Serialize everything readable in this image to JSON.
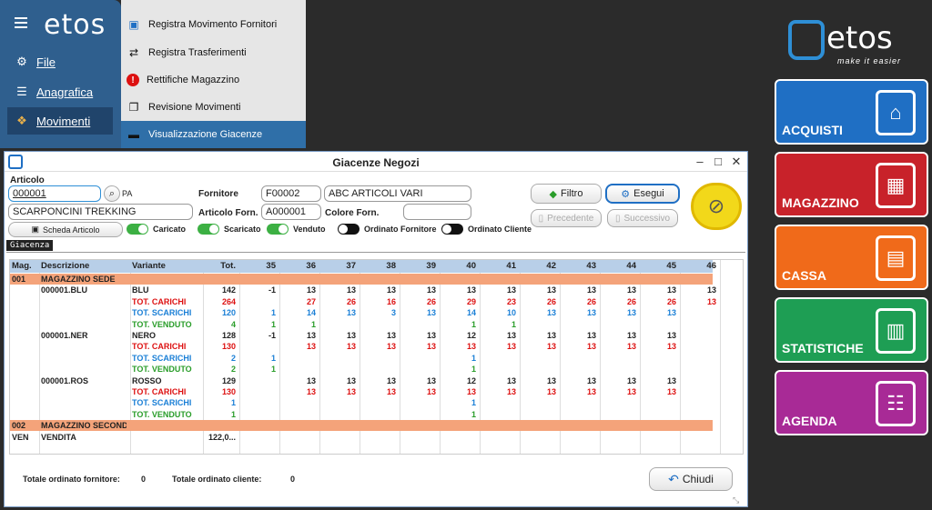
{
  "sidebar": {
    "logo": "etos",
    "items": [
      {
        "label": "File",
        "icon": "gear-icon"
      },
      {
        "label": "Anagrafica",
        "icon": "database-icon"
      },
      {
        "label": "Movimenti",
        "icon": "boxes-icon"
      }
    ]
  },
  "submenu": [
    {
      "label": "Registra Movimento Fornitori",
      "icon": "bag-icon"
    },
    {
      "label": "Registra Trasferimenti",
      "icon": "transfer-icon"
    },
    {
      "label": "Rettifiche Magazzino",
      "icon": "alert-icon"
    },
    {
      "label": "Revisione Movimenti",
      "icon": "documents-icon"
    },
    {
      "label": "Visualizzazione Giacenze",
      "icon": "archive-icon"
    }
  ],
  "brand": {
    "name": "etos",
    "tagline": "make it easier",
    "accent": "#2e8fd6"
  },
  "tiles": [
    {
      "label": "ACQUISTI",
      "color": "#1f6fc4",
      "icon": "shopping-bag-icon"
    },
    {
      "label": "MAGAZZINO",
      "color": "#c8222a",
      "icon": "hand-truck-icon"
    },
    {
      "label": "CASSA",
      "color": "#f06a1a",
      "icon": "cash-register-icon"
    },
    {
      "label": "STATISTICHE",
      "color": "#1e9e54",
      "icon": "chart-icon"
    },
    {
      "label": "AGENDA",
      "color": "#a82a96",
      "icon": "notebook-icon"
    }
  ],
  "window": {
    "title": "Giacenze Negozi",
    "articolo_label": "Articolo",
    "articolo_code": "000001",
    "pa": "PA",
    "articolo_desc": "SCARPONCINI TREKKING",
    "scheda_button": "Scheda Articolo",
    "fornitore_label": "Fornitore",
    "fornitore_code": "F00002",
    "fornitore_name": "ABC ARTICOLI VARI",
    "articolo_forn_label": "Articolo Forn.",
    "articolo_forn_value": "A000001",
    "colore_forn_label": "Colore Forn.",
    "colore_forn_value": "",
    "filtro_button": "Filtro",
    "esegui_button": "Esegui",
    "precedente_button": "Precedente",
    "successivo_button": "Successivo",
    "toggles": [
      {
        "label": "Caricato",
        "on": true
      },
      {
        "label": "Scaricato",
        "on": true
      },
      {
        "label": "Venduto",
        "on": true
      },
      {
        "label": "Ordinato Fornitore",
        "on": false
      },
      {
        "label": "Ordinato Cliente",
        "on": false
      }
    ],
    "tab_label": "Giacenza",
    "totale_fornitore_label": "Totale ordinato fornitore:",
    "totale_fornitore_value": "0",
    "totale_cliente_label": "Totale ordinato cliente:",
    "totale_cliente_value": "0",
    "chiudi_button": "Chiudi"
  },
  "grid": {
    "headers": [
      "Mag.",
      "Descrizione",
      "Variante",
      "Tot.",
      "35",
      "36",
      "37",
      "38",
      "39",
      "40",
      "41",
      "42",
      "43",
      "44",
      "45",
      "46"
    ],
    "rows": [
      {
        "kind": "group",
        "cells": [
          "001",
          "MAGAZZINO SEDE",
          "",
          "",
          "",
          "",
          "",
          "",
          "",
          "",
          "",
          "",
          "",
          "",
          "",
          ""
        ]
      },
      {
        "kind": "main",
        "cells": [
          "",
          "000001.BLU",
          "BLU",
          "142",
          "-1",
          "13",
          "13",
          "13",
          "13",
          "13",
          "13",
          "13",
          "13",
          "13",
          "13",
          "13"
        ]
      },
      {
        "kind": "red",
        "cells": [
          "",
          "",
          "TOT. CARICHI",
          "264",
          "",
          "27",
          "26",
          "16",
          "26",
          "29",
          "23",
          "26",
          "26",
          "26",
          "26",
          "13"
        ]
      },
      {
        "kind": "blue",
        "cells": [
          "",
          "",
          "TOT. SCARICHI",
          "120",
          "1",
          "14",
          "13",
          "3",
          "13",
          "14",
          "10",
          "13",
          "13",
          "13",
          "13",
          ""
        ]
      },
      {
        "kind": "green",
        "cells": [
          "",
          "",
          "TOT. VENDUTO",
          "4",
          "1",
          "1",
          "",
          "",
          "",
          "1",
          "1",
          "",
          "",
          "",
          "",
          ""
        ]
      },
      {
        "kind": "main",
        "cells": [
          "",
          "000001.NER",
          "NERO",
          "128",
          "-1",
          "13",
          "13",
          "13",
          "13",
          "12",
          "13",
          "13",
          "13",
          "13",
          "13",
          ""
        ]
      },
      {
        "kind": "red",
        "cells": [
          "",
          "",
          "TOT. CARICHI",
          "130",
          "",
          "13",
          "13",
          "13",
          "13",
          "13",
          "13",
          "13",
          "13",
          "13",
          "13",
          ""
        ]
      },
      {
        "kind": "blue",
        "cells": [
          "",
          "",
          "TOT. SCARICHI",
          "2",
          "1",
          "",
          "",
          "",
          "",
          "1",
          "",
          "",
          "",
          "",
          "",
          ""
        ]
      },
      {
        "kind": "green",
        "cells": [
          "",
          "",
          "TOT. VENDUTO",
          "2",
          "1",
          "",
          "",
          "",
          "",
          "1",
          "",
          "",
          "",
          "",
          "",
          ""
        ]
      },
      {
        "kind": "main",
        "cells": [
          "",
          "000001.ROS",
          "ROSSO",
          "129",
          "",
          "13",
          "13",
          "13",
          "13",
          "12",
          "13",
          "13",
          "13",
          "13",
          "13",
          ""
        ]
      },
      {
        "kind": "red",
        "cells": [
          "",
          "",
          "TOT. CARICHI",
          "130",
          "",
          "13",
          "13",
          "13",
          "13",
          "13",
          "13",
          "13",
          "13",
          "13",
          "13",
          ""
        ]
      },
      {
        "kind": "blue",
        "cells": [
          "",
          "",
          "TOT. SCARICHI",
          "1",
          "",
          "",
          "",
          "",
          "",
          "1",
          "",
          "",
          "",
          "",
          "",
          ""
        ]
      },
      {
        "kind": "green",
        "cells": [
          "",
          "",
          "TOT. VENDUTO",
          "1",
          "",
          "",
          "",
          "",
          "",
          "1",
          "",
          "",
          "",
          "",
          "",
          ""
        ]
      },
      {
        "kind": "group",
        "cells": [
          "002",
          "MAGAZZINO SECOND...",
          "",
          "",
          "",
          "",
          "",
          "",
          "",
          "",
          "",
          "",
          "",
          "",
          "",
          ""
        ]
      },
      {
        "kind": "main",
        "cells": [
          "VEN",
          "VENDITA",
          "",
          "122,0...",
          "",
          "",
          "",
          "",
          "",
          "",
          "",
          "",
          "",
          "",
          "",
          ""
        ]
      }
    ]
  }
}
